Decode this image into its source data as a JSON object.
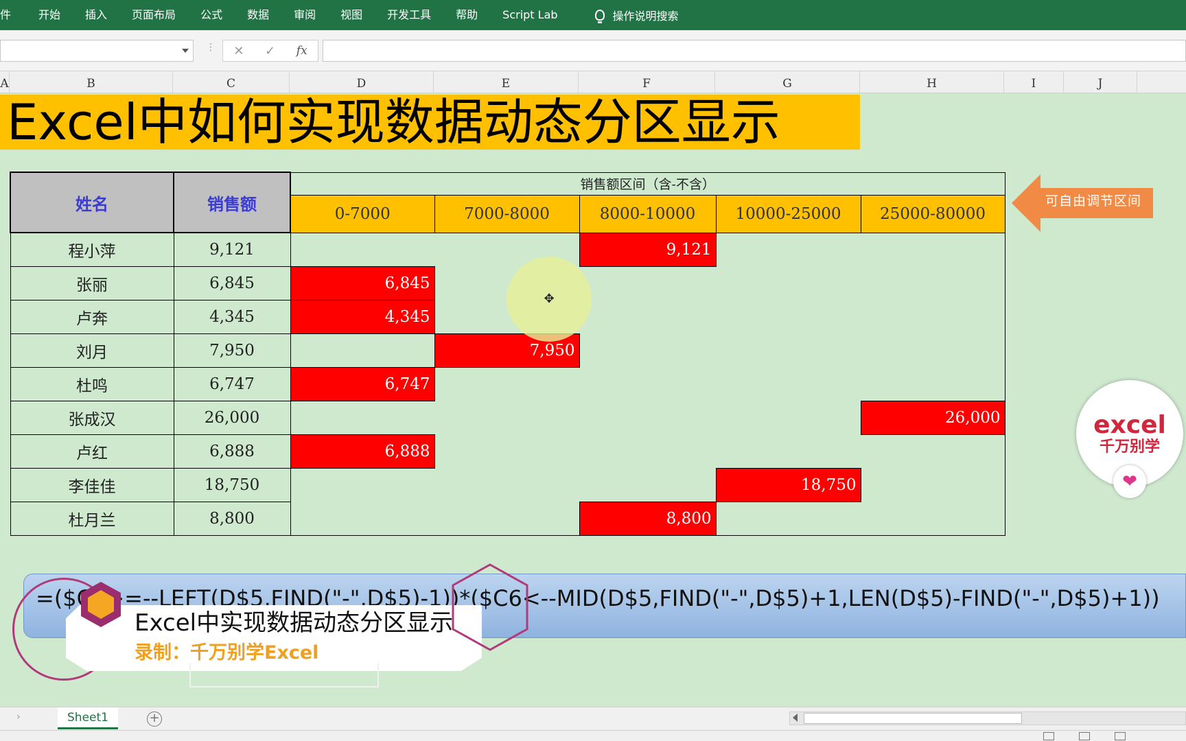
{
  "ribbon": {
    "tabs": [
      "件",
      "开始",
      "插入",
      "页面布局",
      "公式",
      "数据",
      "审阅",
      "视图",
      "开发工具",
      "帮助",
      "Script Lab"
    ],
    "search": "操作说明搜索"
  },
  "formula_bar": {
    "cancel": "✕",
    "enter": "✓",
    "fx": "fx",
    "value": ""
  },
  "columns": [
    "A",
    "B",
    "C",
    "D",
    "E",
    "F",
    "G",
    "H",
    "I",
    "J"
  ],
  "title": "Excel中如何实现数据动态分区显示",
  "table": {
    "name_header": "姓名",
    "sales_header": "销售额",
    "group_header": "销售额区间（含-不含）",
    "ranges": [
      "0-7000",
      "7000-8000",
      "8000-10000",
      "10000-25000",
      "25000-80000"
    ],
    "rows": [
      {
        "name": "程小萍",
        "sales": "9,121",
        "bucket": 2
      },
      {
        "name": "张丽",
        "sales": "6,845",
        "bucket": 0
      },
      {
        "name": "卢奔",
        "sales": "4,345",
        "bucket": 0
      },
      {
        "name": "刘月",
        "sales": "7,950",
        "bucket": 1
      },
      {
        "name": "杜鸣",
        "sales": "6,747",
        "bucket": 0
      },
      {
        "name": "张成汉",
        "sales": "26,000",
        "bucket": 4
      },
      {
        "name": "卢红",
        "sales": "6,888",
        "bucket": 0
      },
      {
        "name": "李佳佳",
        "sales": "18,750",
        "bucket": 3
      },
      {
        "name": "杜月兰",
        "sales": "8,800",
        "bucket": 2
      }
    ]
  },
  "callout": "可自由调节区间",
  "logo": {
    "line1": "excel",
    "line2": "千万别学"
  },
  "formula_overlay": "=($C6>=--LEFT(D$5,FIND(\"-\",D$5)-1))*($C6<--MID(D$5,FIND(\"-\",D$5)+1,LEN(D$5)-FIND(\"-\",D$5)+1))",
  "caption": {
    "title": "Excel中实现数据动态分区显示",
    "subtitle": "录制：千万别学Excel"
  },
  "sheet_tab": "Sheet1",
  "colors": {
    "ribbon": "#217346",
    "banner": "#ffc000",
    "highlight": "#ff0000",
    "sheet_bg": "#cfe9cf",
    "callout": "#f08a45"
  }
}
